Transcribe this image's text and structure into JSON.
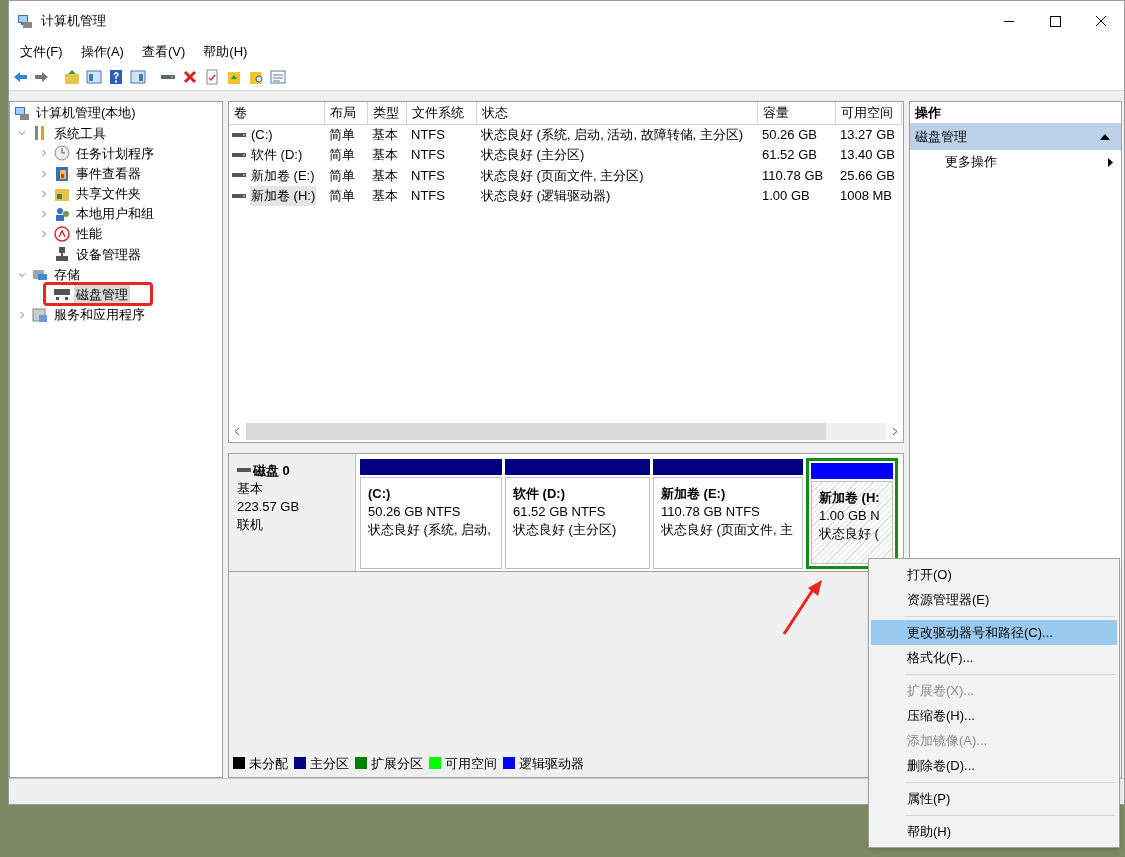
{
  "window": {
    "title": "计算机管理"
  },
  "menu_bar": [
    "文件(F)",
    "操作(A)",
    "查看(V)",
    "帮助(H)"
  ],
  "tree": [
    {
      "label": "计算机管理(本地)",
      "selected": false,
      "children": [
        {
          "label": "系统工具",
          "expanded": true,
          "selected": false,
          "children": [
            {
              "label": "任务计划程序",
              "expanded": false,
              "selected": false
            },
            {
              "label": "事件查看器",
              "expanded": false,
              "selected": false
            },
            {
              "label": "共享文件夹",
              "expanded": false,
              "selected": false
            },
            {
              "label": "本地用户和组",
              "expanded": false,
              "selected": false
            },
            {
              "label": "性能",
              "expanded": false,
              "selected": false
            },
            {
              "label": "设备管理器",
              "selected": false
            }
          ]
        },
        {
          "label": "存储",
          "expanded": true,
          "selected": false,
          "children": [
            {
              "label": "磁盘管理",
              "selected": true
            }
          ]
        },
        {
          "label": "服务和应用程序",
          "expanded": false,
          "selected": false
        }
      ]
    }
  ],
  "volume_table": {
    "columns": [
      "卷",
      "布局",
      "类型",
      "文件系统",
      "状态",
      "容量",
      "可用空间"
    ],
    "rows": [
      {
        "cells": [
          "(C:)",
          "简单",
          "基本",
          "NTFS",
          "状态良好 (系统, 启动, 活动, 故障转储, 主分区)",
          "50.26 GB",
          "13.27 GB"
        ],
        "selected": false
      },
      {
        "cells": [
          "软件 (D:)",
          "简单",
          "基本",
          "NTFS",
          "状态良好 (主分区)",
          "61.52 GB",
          "13.40 GB"
        ],
        "selected": false
      },
      {
        "cells": [
          "新加卷 (E:)",
          "简单",
          "基本",
          "NTFS",
          "状态良好 (页面文件, 主分区)",
          "110.78 GB",
          "25.66 GB"
        ],
        "selected": false
      },
      {
        "cells": [
          "新加卷 (H:)",
          "简单",
          "基本",
          "NTFS",
          "状态良好 (逻辑驱动器)",
          "1.00 GB",
          "1008 MB"
        ],
        "selected": true
      }
    ]
  },
  "disk": {
    "name": "磁盘 0",
    "type": "基本",
    "size": "223.57 GB",
    "status": "联机",
    "partitions": [
      {
        "label": "(C:)",
        "size": "50.26 GB NTFS",
        "status": "状态良好 (系统, 启动,",
        "color": "#000080",
        "selected": false
      },
      {
        "label": "软件 (D:)",
        "size": "61.52 GB NTFS",
        "status": "状态良好 (主分区)",
        "color": "#000080",
        "selected": false
      },
      {
        "label": "新加卷 (E:)",
        "size": "110.78 GB NTFS",
        "status": "状态良好 (页面文件, 主",
        "color": "#000080",
        "selected": false
      },
      {
        "label": "新加卷 (H:",
        "size": "1.00 GB N",
        "status": "状态良好 (",
        "color": "#0000ff",
        "selected": true
      }
    ]
  },
  "legend": [
    {
      "label": "未分配",
      "color": "#000000"
    },
    {
      "label": "主分区",
      "color": "#000080"
    },
    {
      "label": "扩展分区",
      "color": "#008000"
    },
    {
      "label": "可用空间",
      "color": "#00ff00"
    },
    {
      "label": "逻辑驱动器",
      "color": "#0000ff"
    }
  ],
  "actions": {
    "title": "操作",
    "sections": [
      {
        "label": "磁盘管理",
        "expanded": true,
        "items": [
          "更多操作"
        ]
      }
    ]
  },
  "context_menu": [
    {
      "kind": "item",
      "label": "打开(O)",
      "disabled": false,
      "selected": false
    },
    {
      "kind": "item",
      "label": "资源管理器(E)",
      "disabled": false,
      "selected": false
    },
    {
      "kind": "separator"
    },
    {
      "kind": "item",
      "label": "更改驱动器号和路径(C)...",
      "disabled": false,
      "selected": true
    },
    {
      "kind": "item",
      "label": "格式化(F)...",
      "disabled": false,
      "selected": false
    },
    {
      "kind": "separator"
    },
    {
      "kind": "item",
      "label": "扩展卷(X)...",
      "disabled": true,
      "selected": false
    },
    {
      "kind": "item",
      "label": "压缩卷(H)...",
      "disabled": false,
      "selected": false
    },
    {
      "kind": "item",
      "label": "添加镜像(A)...",
      "disabled": true,
      "selected": false
    },
    {
      "kind": "item",
      "label": "删除卷(D)...",
      "disabled": false,
      "selected": false
    },
    {
      "kind": "separator"
    },
    {
      "kind": "item",
      "label": "属性(P)",
      "disabled": false,
      "selected": false
    },
    {
      "kind": "separator"
    },
    {
      "kind": "item",
      "label": "帮助(H)",
      "disabled": false,
      "selected": false
    }
  ]
}
